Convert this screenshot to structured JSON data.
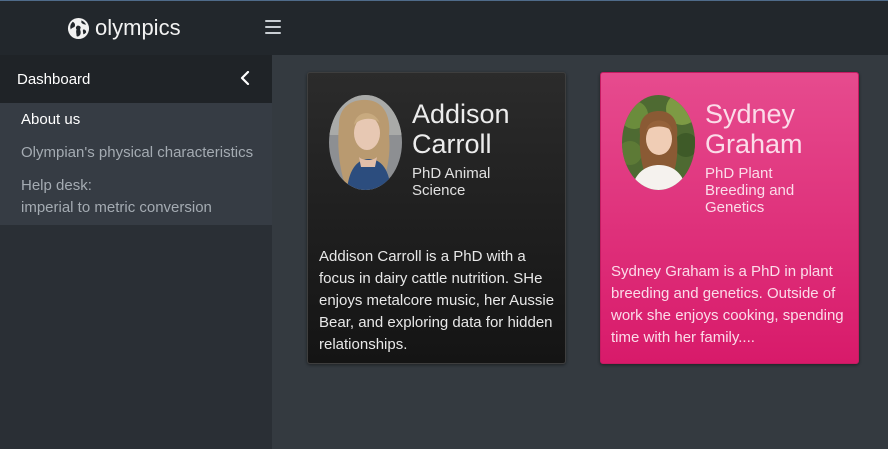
{
  "header": {
    "brand_name": "olympics",
    "brand_icon": "globe-icon",
    "menu_icon": "hamburger-icon"
  },
  "sidebar": {
    "dashboard_label": "Dashboard",
    "collapse_icon": "chevron-left-icon",
    "items": [
      {
        "label": "About us",
        "active": true
      },
      {
        "label": "Olympian's physical characteristics",
        "active": false
      },
      {
        "label_line1": "Help desk:",
        "label_line2": "imperial to metric conversion",
        "active": false
      }
    ]
  },
  "cards": [
    {
      "name": "Addison Carroll",
      "subtitle": "PhD Animal Science",
      "description": "Addison Carroll is a PhD with a focus in dairy cattle nutrition. SHe enjoys metalcore music, her Aussie Bear, and exploring data for hidden relationships."
    },
    {
      "name": "Sydney Graham",
      "subtitle": "PhD Plant Breeding and Genetics",
      "description": "Sydney Graham is a PhD in plant breeding and genetics. Outside of work she enjoys cooking, spending time with her family...."
    }
  ],
  "colors": {
    "header_bg": "#22272c",
    "sidebar_bg": "#2a2f35",
    "main_bg": "#343a40",
    "card_dark": "#1f1f1f",
    "card_pink": "#e0317b"
  }
}
